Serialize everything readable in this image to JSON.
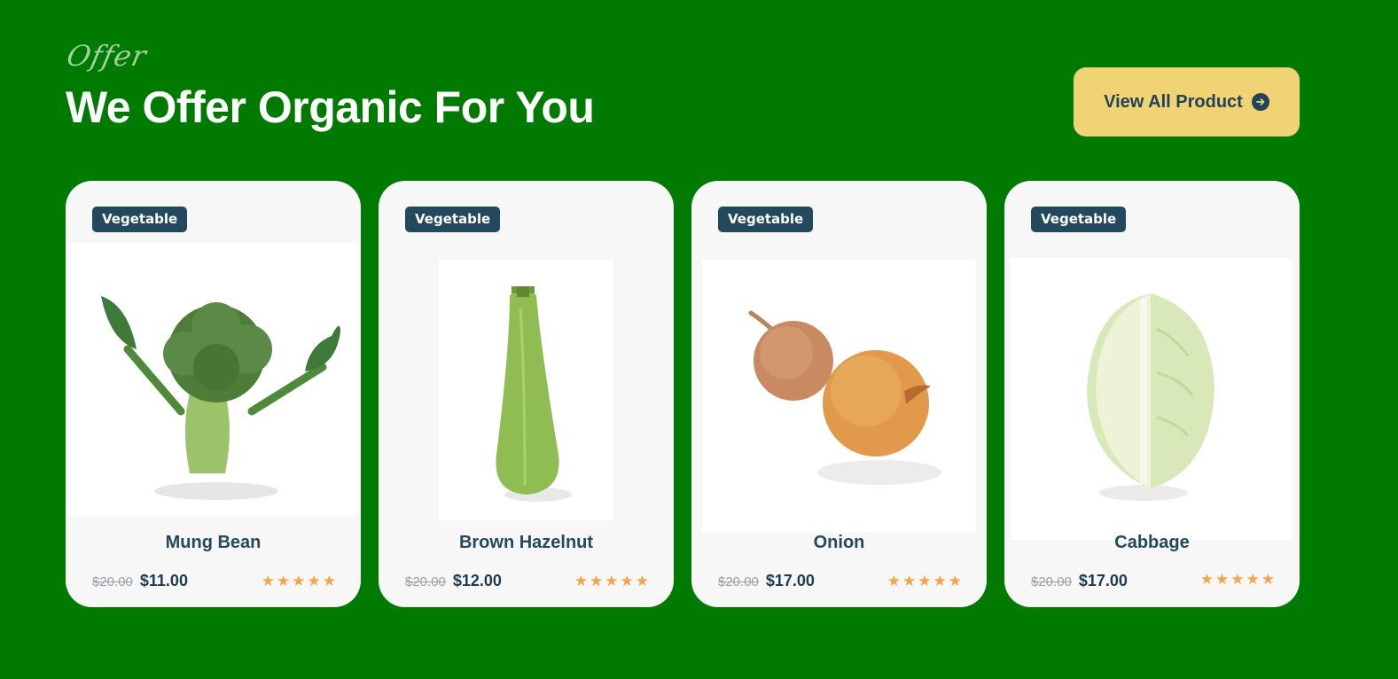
{
  "section": {
    "eyebrow": "Offer",
    "title": "We Offer Organic For You",
    "view_all_label": "View All Product",
    "view_all_icon": "arrow-right-circle-icon"
  },
  "colors": {
    "background": "#017a02",
    "button": "#f0d373",
    "badge": "#23495e",
    "star": "#f7a348"
  },
  "products": [
    {
      "badge": "Vegetable",
      "name": "Mung Bean",
      "old_price": "$20.00",
      "price": "$11.00",
      "rating": 5,
      "image_icon": "broccoli-image"
    },
    {
      "badge": "Vegetable",
      "name": "Brown Hazelnut",
      "old_price": "$20.00",
      "price": "$12.00",
      "rating": 5,
      "image_icon": "zucchini-image"
    },
    {
      "badge": "Vegetable",
      "name": "Onion",
      "old_price": "$20.00",
      "price": "$17.00",
      "rating": 5,
      "image_icon": "onion-image"
    },
    {
      "badge": "Vegetable",
      "name": "Cabbage",
      "old_price": "$20.00",
      "price": "$17.00",
      "rating": 5,
      "image_icon": "cabbage-image"
    }
  ]
}
